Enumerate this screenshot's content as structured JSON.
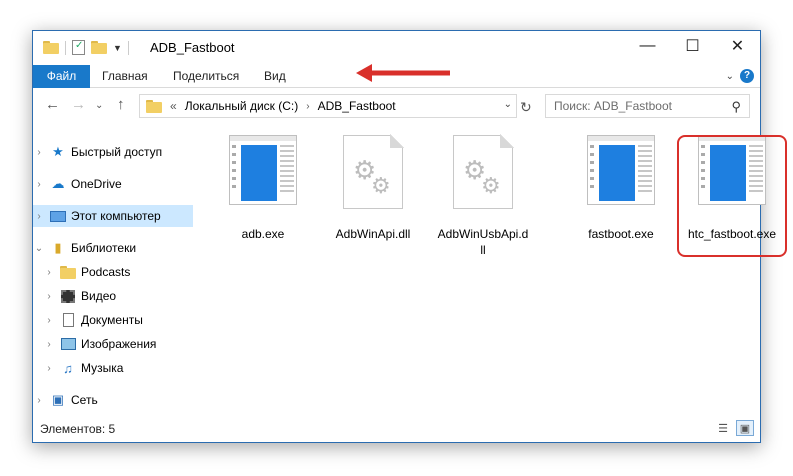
{
  "window": {
    "title": "ADB_Fastboot",
    "controls": {
      "minimize": "—",
      "maximize": "☐",
      "close": "✕"
    }
  },
  "ribbon": {
    "tabs": [
      "Файл",
      "Главная",
      "Поделиться",
      "Вид"
    ]
  },
  "address": {
    "prefix": "«",
    "crumbs": [
      "Локальный диск (C:)",
      "ADB_Fastboot"
    ]
  },
  "search": {
    "placeholder": "Поиск: ADB_Fastboot"
  },
  "sidebar": {
    "items": [
      {
        "label": "Быстрый доступ",
        "icon": "star-icon"
      },
      {
        "label": "OneDrive",
        "icon": "cloud-icon"
      },
      {
        "label": "Этот компьютер",
        "icon": "computer-icon",
        "selected": true
      },
      {
        "label": "Библиотеки",
        "icon": "library-icon",
        "expanded": true
      },
      {
        "label": "Podcasts",
        "icon": "folder-icon"
      },
      {
        "label": "Видео",
        "icon": "video-icon"
      },
      {
        "label": "Документы",
        "icon": "document-icon"
      },
      {
        "label": "Изображения",
        "icon": "image-icon"
      },
      {
        "label": "Музыка",
        "icon": "music-icon"
      },
      {
        "label": "Сеть",
        "icon": "network-icon"
      }
    ]
  },
  "files": [
    {
      "name": "adb.exe",
      "type": "exe"
    },
    {
      "name": "AdbWinApi.dll",
      "type": "dll"
    },
    {
      "name": "AdbWinUsbApi.dll",
      "name_line1": "AdbWinUsbApi.d",
      "name_line2": "ll",
      "type": "dll"
    },
    {
      "name": "fastboot.exe",
      "type": "exe"
    },
    {
      "name": "htc_fastboot.exe",
      "type": "exe",
      "highlighted": true
    }
  ],
  "status": {
    "items_count": "Элементов: 5"
  },
  "colors": {
    "accent": "#1979ca",
    "annotation": "#d9302b",
    "selection": "#cce8ff"
  }
}
